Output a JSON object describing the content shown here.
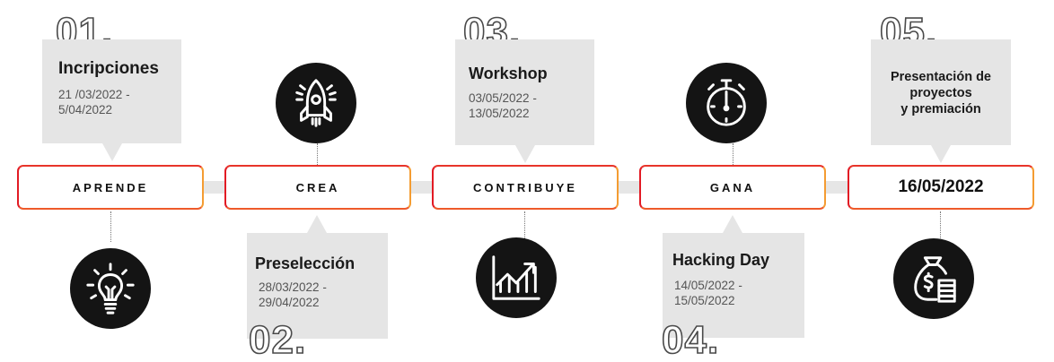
{
  "stages": [
    {
      "label": "APRENDE"
    },
    {
      "label": "CREA"
    },
    {
      "label": "CONTRIBUYE"
    },
    {
      "label": "GANA"
    },
    {
      "label": "16/05/2022"
    }
  ],
  "steps": [
    {
      "number": "01.",
      "title": "Incripciones",
      "date_line1": "21 /03/2022 -",
      "date_line2": "5/04/2022"
    },
    {
      "number": "02.",
      "title": "Preselección",
      "date_line1": "28/03/2022 -",
      "date_line2": "29/04/2022"
    },
    {
      "number": "03.",
      "title": "Workshop",
      "date_line1": "03/05/2022 -",
      "date_line2": "13/05/2022"
    },
    {
      "number": "04.",
      "title": "Hacking Day",
      "date_line1": "14/05/2022 -",
      "date_line2": "15/05/2022"
    },
    {
      "number": "05.",
      "title_line1": "Presentación de",
      "title_line2": "proyectos",
      "title_line3": "y premiación"
    }
  ],
  "icons": [
    "lightbulb-icon",
    "rocket-icon",
    "growth-chart-icon",
    "stopwatch-icon",
    "money-bag-icon"
  ],
  "colors": {
    "accent_red": "#e21b24",
    "accent_orange": "#f49c32",
    "card_gray": "#e5e5e5",
    "icon_bg": "#141414"
  }
}
